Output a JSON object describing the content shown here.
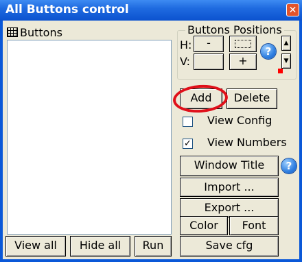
{
  "window": {
    "title": "All Buttons control",
    "close_glyph": "✕"
  },
  "list": {
    "header": "Buttons",
    "icon": "list-icon",
    "items": []
  },
  "bottom": {
    "view_all": "View all",
    "hide_all": "Hide all",
    "run": "Run"
  },
  "positions": {
    "label": "Buttons Positions",
    "h_label": "H:",
    "v_label": "V:",
    "minus": "-",
    "plus": "+",
    "arrow_up": "▲",
    "arrow_down": "▼",
    "help": "?"
  },
  "actions": {
    "add": "Add",
    "delete": "Delete",
    "view_config": "View Config",
    "view_config_checked": false,
    "view_numbers": "View Numbers",
    "view_numbers_checked": true,
    "window_title": "Window Title",
    "help": "?",
    "import": "Import ...",
    "export": "Export ...",
    "color": "Color",
    "font": "Font",
    "save_cfg": "Save cfg"
  },
  "colors": {
    "title_bar": "#0b52cf",
    "client": "#ece9d8",
    "highlight": "#e0101a",
    "position_indicator": "#ff0000"
  }
}
